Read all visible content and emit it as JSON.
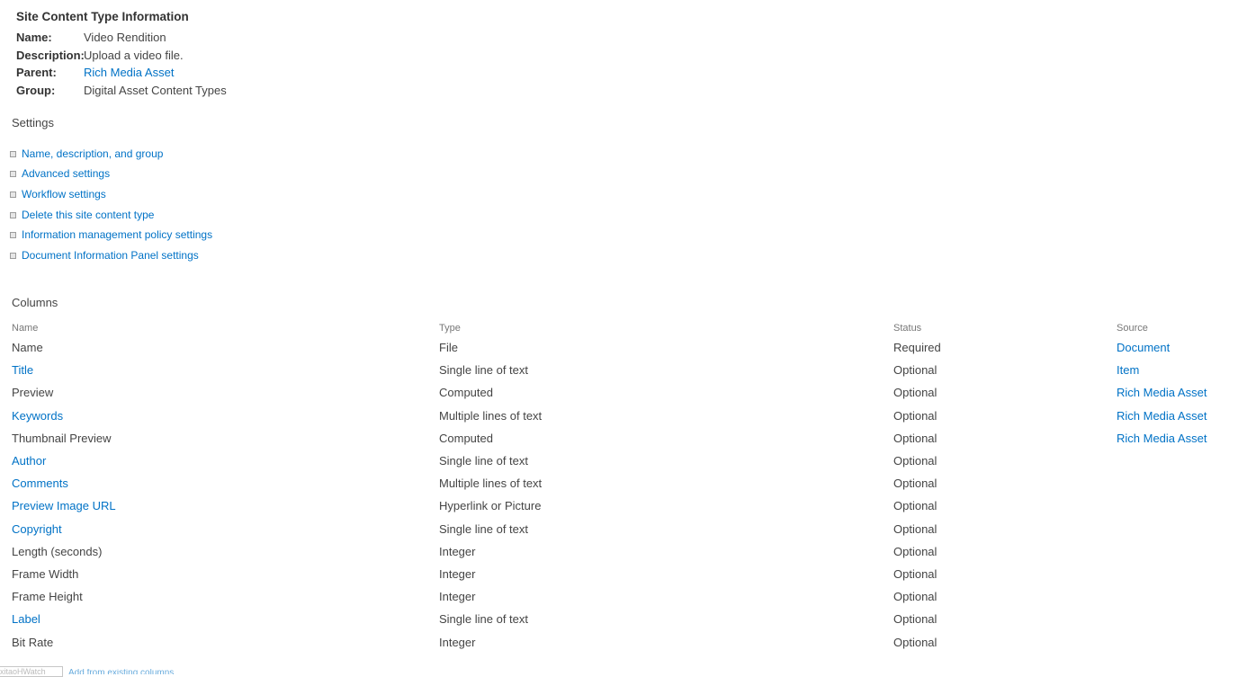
{
  "info": {
    "title": "Site Content Type Information",
    "rows": [
      {
        "label": "Name:",
        "value": "Video Rendition",
        "is_link": false
      },
      {
        "label": "Description:",
        "value": "Upload a video file.",
        "is_link": false
      },
      {
        "label": "Parent:",
        "value": "Rich Media Asset",
        "is_link": true
      },
      {
        "label": "Group:",
        "value": "Digital Asset Content Types",
        "is_link": false
      }
    ]
  },
  "settings": {
    "title": "Settings",
    "items": [
      {
        "label": "Name, description, and group"
      },
      {
        "label": "Advanced settings"
      },
      {
        "label": "Workflow settings"
      },
      {
        "label": "Delete this site content type"
      },
      {
        "label": "Information management policy settings"
      },
      {
        "label": "Document Information Panel settings"
      }
    ]
  },
  "columns": {
    "title": "Columns",
    "headers": {
      "name": "Name",
      "type": "Type",
      "status": "Status",
      "source": "Source"
    },
    "rows": [
      {
        "name": "Name",
        "name_link": false,
        "type": "File",
        "status": "Required",
        "source": "Document"
      },
      {
        "name": "Title",
        "name_link": true,
        "type": "Single line of text",
        "status": "Optional",
        "source": "Item"
      },
      {
        "name": "Preview",
        "name_link": false,
        "type": "Computed",
        "status": "Optional",
        "source": "Rich Media Asset"
      },
      {
        "name": "Keywords",
        "name_link": true,
        "type": "Multiple lines of text",
        "status": "Optional",
        "source": "Rich Media Asset"
      },
      {
        "name": "Thumbnail Preview",
        "name_link": false,
        "type": "Computed",
        "status": "Optional",
        "source": "Rich Media Asset"
      },
      {
        "name": "Author",
        "name_link": true,
        "type": "Single line of text",
        "status": "Optional",
        "source": ""
      },
      {
        "name": "Comments",
        "name_link": true,
        "type": "Multiple lines of text",
        "status": "Optional",
        "source": ""
      },
      {
        "name": "Preview Image URL",
        "name_link": true,
        "type": "Hyperlink or Picture",
        "status": "Optional",
        "source": ""
      },
      {
        "name": "Copyright",
        "name_link": true,
        "type": "Single line of text",
        "status": "Optional",
        "source": ""
      },
      {
        "name": "Length (seconds)",
        "name_link": false,
        "type": "Integer",
        "status": "Optional",
        "source": ""
      },
      {
        "name": "Frame Width",
        "name_link": false,
        "type": "Integer",
        "status": "Optional",
        "source": ""
      },
      {
        "name": "Frame Height",
        "name_link": false,
        "type": "Integer",
        "status": "Optional",
        "source": ""
      },
      {
        "name": "Label",
        "name_link": true,
        "type": "Single line of text",
        "status": "Optional",
        "source": ""
      },
      {
        "name": "Bit Rate",
        "name_link": false,
        "type": "Integer",
        "status": "Optional",
        "source": ""
      }
    ]
  },
  "footer": {
    "box_text": "xitaoHWatch",
    "link_text": "Add from existing columns"
  },
  "colors": {
    "link": "#0072c6",
    "text": "#444444",
    "header_text": "#777777"
  }
}
